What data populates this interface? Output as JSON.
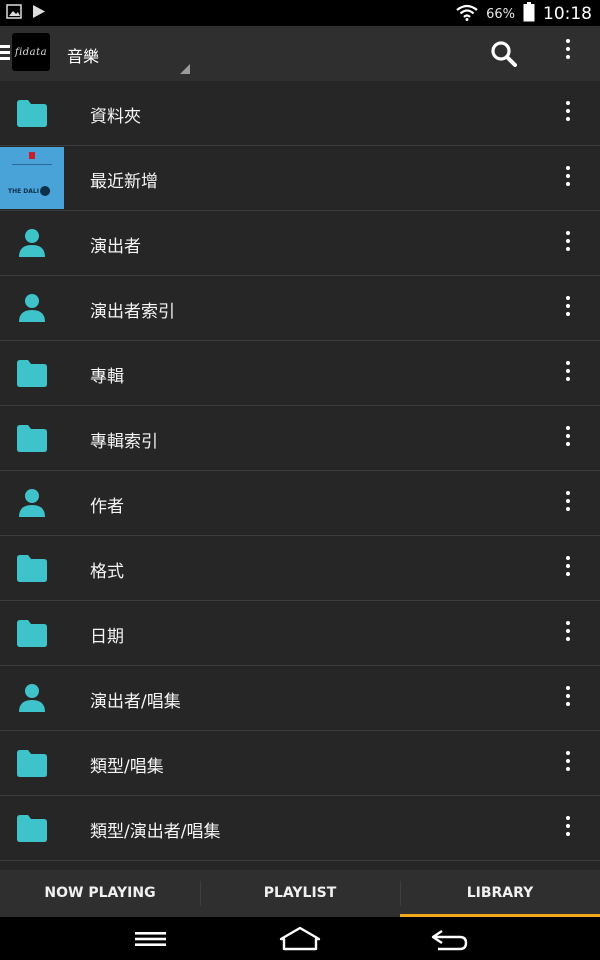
{
  "status_bar": {
    "battery_percent": "66%",
    "time": "10:18",
    "icons": [
      "gallery-icon",
      "play-icon",
      "wifi-icon",
      "battery-icon"
    ]
  },
  "app_bar": {
    "logo_text": "fidata",
    "title": "音樂",
    "icons": [
      "drawer-icon",
      "search-icon",
      "more-options-icon"
    ]
  },
  "library": {
    "items": [
      {
        "label": "資料夾",
        "icon": "folder-icon"
      },
      {
        "label": "最近新增",
        "icon": "album-art"
      },
      {
        "label": "演出者",
        "icon": "person-icon"
      },
      {
        "label": "演出者索引",
        "icon": "person-icon"
      },
      {
        "label": "專輯",
        "icon": "folder-icon"
      },
      {
        "label": "專輯索引",
        "icon": "folder-icon"
      },
      {
        "label": "作者",
        "icon": "person-icon"
      },
      {
        "label": "格式",
        "icon": "folder-icon"
      },
      {
        "label": "日期",
        "icon": "folder-icon"
      },
      {
        "label": "演出者/唱集",
        "icon": "person-icon"
      },
      {
        "label": "類型/唱集",
        "icon": "folder-icon"
      },
      {
        "label": "類型/演出者/唱集",
        "icon": "folder-icon"
      }
    ],
    "album_art_text": "THE DALI CD"
  },
  "tabs": [
    {
      "label": "NOW PLAYING",
      "active": false
    },
    {
      "label": "PLAYLIST",
      "active": false
    },
    {
      "label": "LIBRARY",
      "active": true
    }
  ],
  "colors": {
    "accent_tab": "#f2a81d",
    "icon_teal": "#3fc3cb",
    "background": "#262626",
    "bar": "#2f2f2f"
  },
  "nav_bar": {
    "icons": [
      "recent-apps-icon",
      "home-icon",
      "back-icon"
    ]
  }
}
